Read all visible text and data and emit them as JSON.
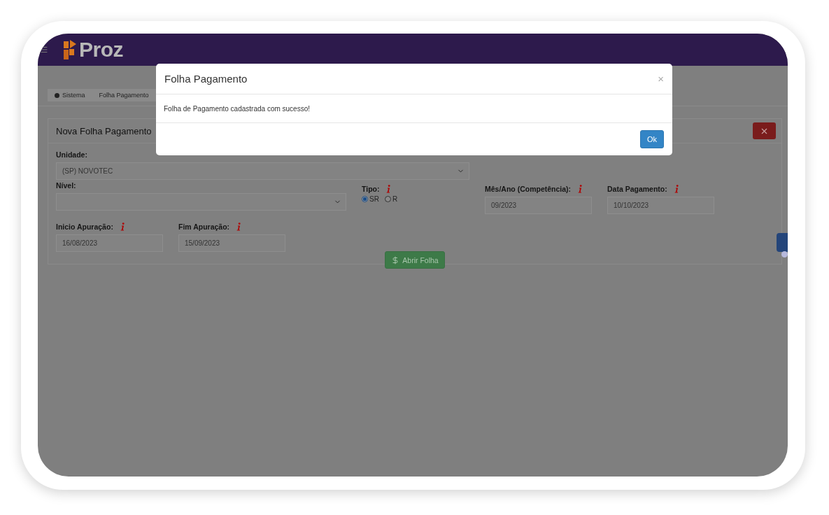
{
  "app": {
    "brand": "Proz"
  },
  "breadcrumb": [
    {
      "label": "Sistema"
    },
    {
      "label": "Folha Pagamento"
    }
  ],
  "panel": {
    "title": "Nova Folha Pagamento",
    "fields": [
      {
        "kind": "select",
        "label": "Unidade:",
        "value": "(SP) NOVOTEC",
        "info": false
      },
      {
        "kind": "select",
        "label": "Nível:",
        "info": false
      },
      {
        "kind": "radio",
        "label": "Tipo:",
        "info": true,
        "options": [
          {
            "label": "SR",
            "selected": true
          },
          {
            "label": "R",
            "selected": false
          }
        ]
      },
      {
        "kind": "text",
        "label": "Mês/Ano (Competência):",
        "value": "09/2023",
        "info": true
      },
      {
        "kind": "text",
        "label": "Data Pagamento:",
        "value": "10/10/2023",
        "info": true
      },
      {
        "kind": "text",
        "label": "Inicio Apuração:",
        "value": "16/08/2023",
        "info": true
      },
      {
        "kind": "text",
        "label": "Fim Apuração:",
        "value": "15/09/2023",
        "info": true
      }
    ],
    "submit": "Abrir Folha"
  },
  "modal": {
    "title": "Folha Pagamento",
    "close": "×",
    "message": "Folha de Pagamento cadastrada com sucesso!",
    "button": "Ok"
  }
}
